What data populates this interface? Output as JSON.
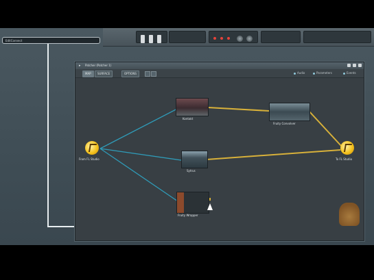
{
  "hint_bar": {
    "text": "EditConnect"
  },
  "patcher": {
    "title": "Patcher (Patcher 1)",
    "tabs": [
      "MAP",
      "SURFACE",
      "OPTIONS"
    ],
    "options": [
      "Audio",
      "Parameters",
      "Events"
    ]
  },
  "nodes": {
    "kontakt": "Kontakt",
    "fruity_convolver": "Fruity Convolver",
    "from_fl": "From FL Studio",
    "sytrus": "Sytrus",
    "to_fl": "To FL Studio",
    "fruity_wrapper": "Fruity Wrapper"
  },
  "colors": {
    "audio_wire": "#d8b13a",
    "event_wire": "#2f9bb8",
    "guide": "#e8eef0"
  },
  "icons": {
    "fl_node": "fl-studio-fruit-icon",
    "watermark": "fl-studio-logo-icon"
  }
}
